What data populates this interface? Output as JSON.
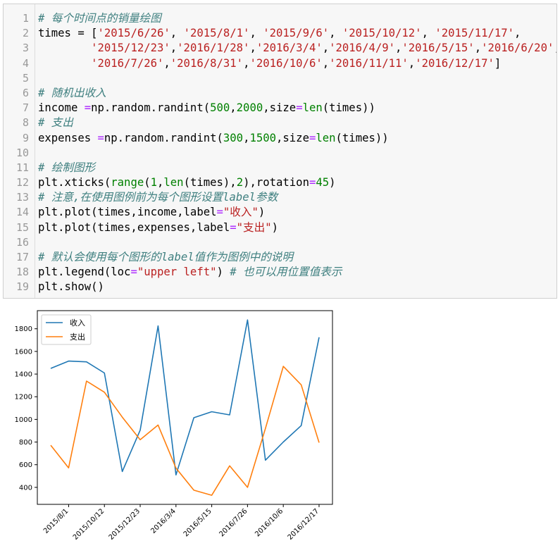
{
  "code": {
    "lines": [
      {
        "no": "1",
        "tokens": [
          {
            "t": "# 每个时间点的销量绘图",
            "c": "cm"
          }
        ]
      },
      {
        "no": "2",
        "tokens": [
          {
            "t": "times = [",
            "c": ""
          },
          {
            "t": "'2015/6/26'",
            "c": "st"
          },
          {
            "t": ", ",
            "c": ""
          },
          {
            "t": "'2015/8/1'",
            "c": "st"
          },
          {
            "t": ", ",
            "c": ""
          },
          {
            "t": "'2015/9/6'",
            "c": "st"
          },
          {
            "t": ", ",
            "c": ""
          },
          {
            "t": "'2015/10/12'",
            "c": "st"
          },
          {
            "t": ", ",
            "c": ""
          },
          {
            "t": "'2015/11/17'",
            "c": "st"
          },
          {
            "t": ",",
            "c": ""
          }
        ]
      },
      {
        "no": "3",
        "tokens": [
          {
            "t": "        ",
            "c": ""
          },
          {
            "t": "'2015/12/23'",
            "c": "st"
          },
          {
            "t": ",",
            "c": ""
          },
          {
            "t": "'2016/1/28'",
            "c": "st"
          },
          {
            "t": ",",
            "c": ""
          },
          {
            "t": "'2016/3/4'",
            "c": "st"
          },
          {
            "t": ",",
            "c": ""
          },
          {
            "t": "'2016/4/9'",
            "c": "st"
          },
          {
            "t": ",",
            "c": ""
          },
          {
            "t": "'2016/5/15'",
            "c": "st"
          },
          {
            "t": ",",
            "c": ""
          },
          {
            "t": "'2016/6/20'",
            "c": "st"
          },
          {
            "t": ",",
            "c": ""
          }
        ]
      },
      {
        "no": "4",
        "tokens": [
          {
            "t": "        ",
            "c": ""
          },
          {
            "t": "'2016/7/26'",
            "c": "st"
          },
          {
            "t": ",",
            "c": ""
          },
          {
            "t": "'2016/8/31'",
            "c": "st"
          },
          {
            "t": ",",
            "c": ""
          },
          {
            "t": "'2016/10/6'",
            "c": "st"
          },
          {
            "t": ",",
            "c": ""
          },
          {
            "t": "'2016/11/11'",
            "c": "st"
          },
          {
            "t": ",",
            "c": ""
          },
          {
            "t": "'2016/12/17'",
            "c": "st"
          },
          {
            "t": "]",
            "c": ""
          }
        ]
      },
      {
        "no": "5",
        "tokens": []
      },
      {
        "no": "6",
        "tokens": [
          {
            "t": "# 随机出收入",
            "c": "cm"
          }
        ]
      },
      {
        "no": "7",
        "tokens": [
          {
            "t": "income ",
            "c": ""
          },
          {
            "t": "=",
            "c": "op"
          },
          {
            "t": "np.random.randint(",
            "c": ""
          },
          {
            "t": "500",
            "c": "nu"
          },
          {
            "t": ",",
            "c": ""
          },
          {
            "t": "2000",
            "c": "nu"
          },
          {
            "t": ",size",
            "c": ""
          },
          {
            "t": "=",
            "c": "op"
          },
          {
            "t": "len",
            "c": "kw"
          },
          {
            "t": "(times))",
            "c": ""
          }
        ]
      },
      {
        "no": "8",
        "tokens": [
          {
            "t": "# 支出",
            "c": "cm"
          }
        ]
      },
      {
        "no": "9",
        "tokens": [
          {
            "t": "expenses ",
            "c": ""
          },
          {
            "t": "=",
            "c": "op"
          },
          {
            "t": "np.random.randint(",
            "c": ""
          },
          {
            "t": "300",
            "c": "nu"
          },
          {
            "t": ",",
            "c": ""
          },
          {
            "t": "1500",
            "c": "nu"
          },
          {
            "t": ",size",
            "c": ""
          },
          {
            "t": "=",
            "c": "op"
          },
          {
            "t": "len",
            "c": "kw"
          },
          {
            "t": "(times))",
            "c": ""
          }
        ]
      },
      {
        "no": "10",
        "tokens": []
      },
      {
        "no": "11",
        "tokens": [
          {
            "t": "# 绘制图形",
            "c": "cm"
          }
        ]
      },
      {
        "no": "12",
        "tokens": [
          {
            "t": "plt.xticks(",
            "c": ""
          },
          {
            "t": "range",
            "c": "kw"
          },
          {
            "t": "(",
            "c": ""
          },
          {
            "t": "1",
            "c": "nu"
          },
          {
            "t": ",",
            "c": ""
          },
          {
            "t": "len",
            "c": "kw"
          },
          {
            "t": "(times),",
            "c": ""
          },
          {
            "t": "2",
            "c": "nu"
          },
          {
            "t": "),rotation",
            "c": ""
          },
          {
            "t": "=",
            "c": "op"
          },
          {
            "t": "45",
            "c": "nu"
          },
          {
            "t": ")",
            "c": ""
          }
        ]
      },
      {
        "no": "13",
        "tokens": [
          {
            "t": "# 注意,在使用图例前为每个图形设置label参数",
            "c": "cm"
          }
        ]
      },
      {
        "no": "14",
        "tokens": [
          {
            "t": "plt.plot(times,income,label",
            "c": ""
          },
          {
            "t": "=",
            "c": "op"
          },
          {
            "t": "\"收入\"",
            "c": "st"
          },
          {
            "t": ")",
            "c": ""
          }
        ]
      },
      {
        "no": "15",
        "tokens": [
          {
            "t": "plt.plot(times,expenses,label",
            "c": ""
          },
          {
            "t": "=",
            "c": "op"
          },
          {
            "t": "\"支出\"",
            "c": "st"
          },
          {
            "t": ")",
            "c": ""
          }
        ]
      },
      {
        "no": "16",
        "tokens": []
      },
      {
        "no": "17",
        "tokens": [
          {
            "t": "# 默认会使用每个图形的label值作为图例中的说明",
            "c": "cm"
          }
        ]
      },
      {
        "no": "18",
        "tokens": [
          {
            "t": "plt.legend(loc",
            "c": ""
          },
          {
            "t": "=",
            "c": "op"
          },
          {
            "t": "\"upper left\"",
            "c": "st"
          },
          {
            "t": ") ",
            "c": ""
          },
          {
            "t": "# 也可以用位置值表示",
            "c": "cm"
          }
        ]
      },
      {
        "no": "19",
        "tokens": [
          {
            "t": "plt.show()",
            "c": ""
          }
        ]
      }
    ]
  },
  "chart_data": {
    "type": "line",
    "x": [
      "2015/6/26",
      "2015/8/1",
      "2015/9/6",
      "2015/10/12",
      "2015/11/17",
      "2015/12/23",
      "2016/1/28",
      "2016/3/4",
      "2016/4/9",
      "2016/5/15",
      "2016/6/20",
      "2016/7/26",
      "2016/8/31",
      "2016/10/6",
      "2016/11/11",
      "2016/12/17"
    ],
    "xtick_labels": [
      "2015/8/1",
      "2015/10/12",
      "2015/12/23",
      "2016/3/4",
      "2016/5/15",
      "2016/7/26",
      "2016/10/6",
      "2016/12/17"
    ],
    "series": [
      {
        "name": "收入",
        "color": "#1f77b4",
        "values": [
          1450,
          1515,
          1508,
          1410,
          540,
          905,
          1825,
          510,
          1015,
          1068,
          1040,
          1878,
          640,
          800,
          945,
          1725
        ]
      },
      {
        "name": "支出",
        "color": "#ff7f0e",
        "values": [
          772,
          572,
          1338,
          1240,
          1020,
          820,
          950,
          570,
          375,
          330,
          590,
          400,
          920,
          1468,
          1305,
          795
        ]
      }
    ],
    "yticks": [
      400,
      600,
      800,
      1000,
      1200,
      1400,
      1600,
      1800
    ],
    "ylim": [
      250,
      1960
    ],
    "legend": "upper left",
    "title": "",
    "xlabel": "",
    "ylabel": ""
  }
}
